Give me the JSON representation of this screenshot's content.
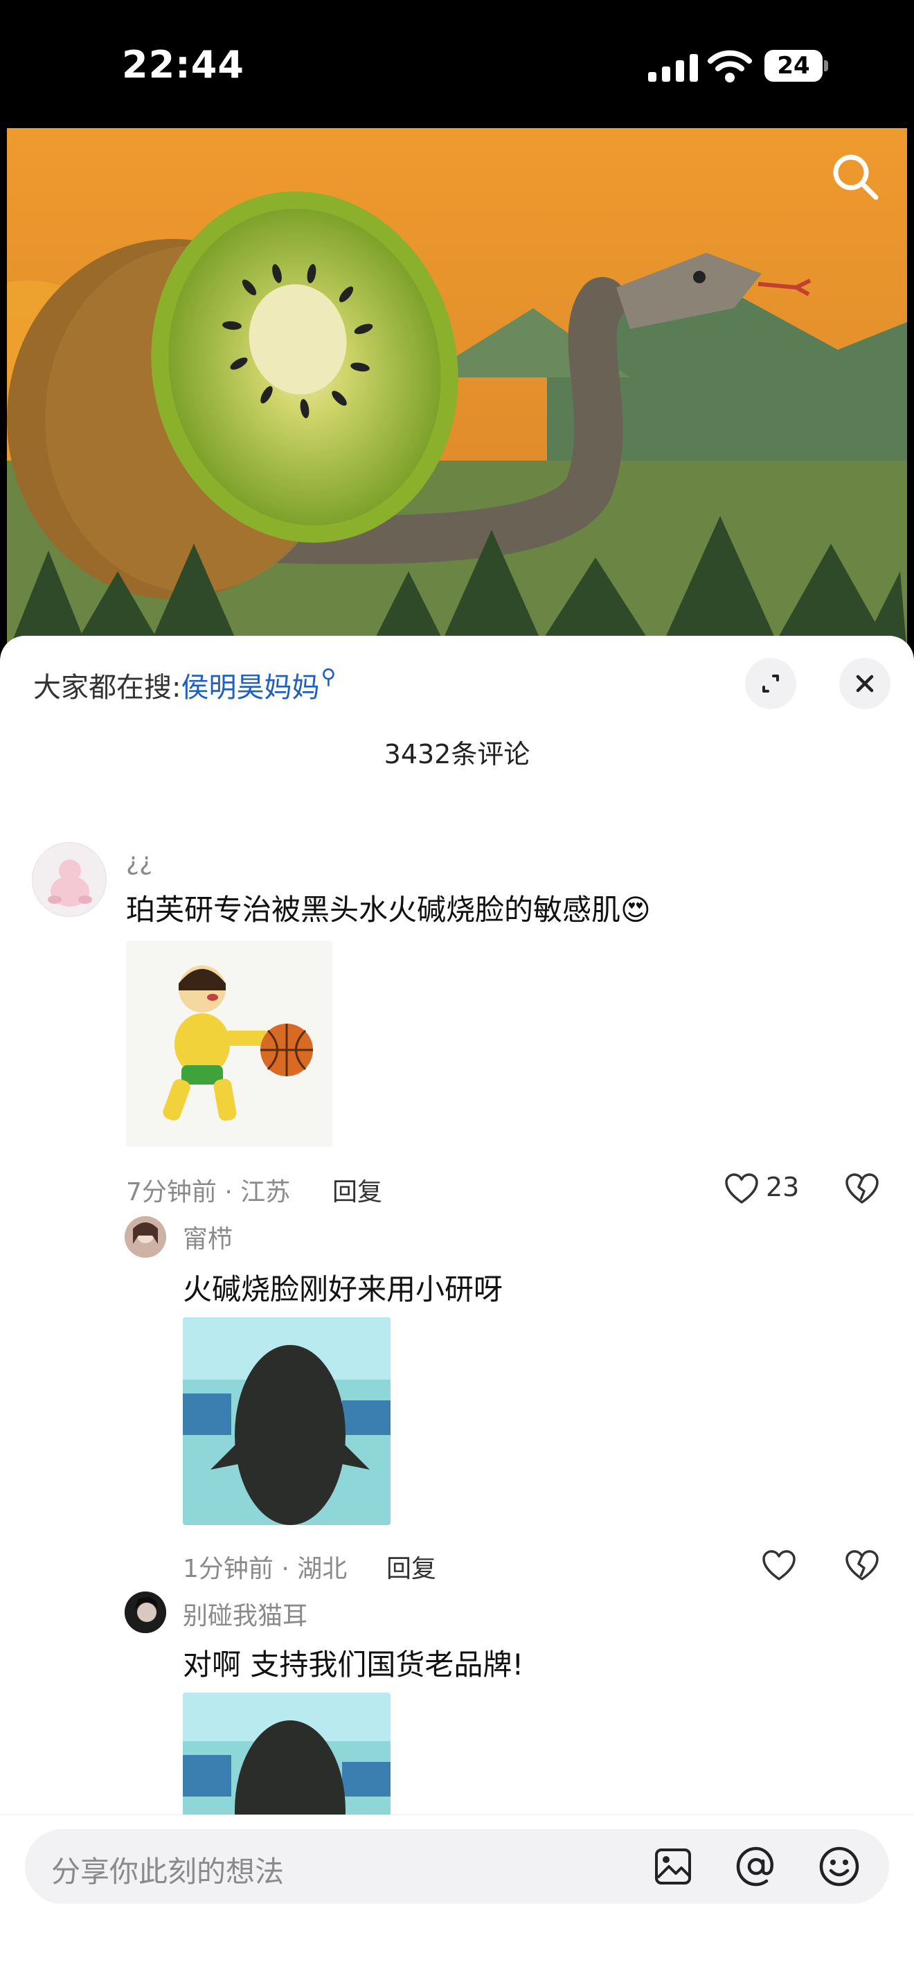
{
  "status_bar": {
    "time": "22:44",
    "battery": "24"
  },
  "comments_panel": {
    "hot_search_prefix": "大家都在搜:",
    "hot_search_keyword": "侯明昊妈妈",
    "comment_count": "3432条评论"
  },
  "comments": [
    {
      "username": "¿¿",
      "text": "珀芙研专治被黑头水火碱烧脸的敏感肌😍",
      "meta": "7分钟前 · 江苏",
      "reply": "回复",
      "likes": "23"
    },
    {
      "username": "甯栉",
      "text": "火碱烧脸刚好来用小研呀",
      "meta": "1分钟前 · 湖北",
      "reply": "回复"
    },
    {
      "username": "别碰我猫耳",
      "text": "对啊 支持我们国货老品牌!"
    }
  ],
  "input": {
    "placeholder": "分享你此刻的想法"
  },
  "icons": {
    "search": "search-icon",
    "expand": "expand-icon",
    "close": "close-icon",
    "like": "heart-icon",
    "dislike": "broken-heart-icon",
    "image": "image-icon",
    "mention": "at-icon",
    "emoji": "emoji-icon"
  },
  "colors": {
    "accent": "#1f5fbf",
    "video_sky": "#e8902c"
  }
}
